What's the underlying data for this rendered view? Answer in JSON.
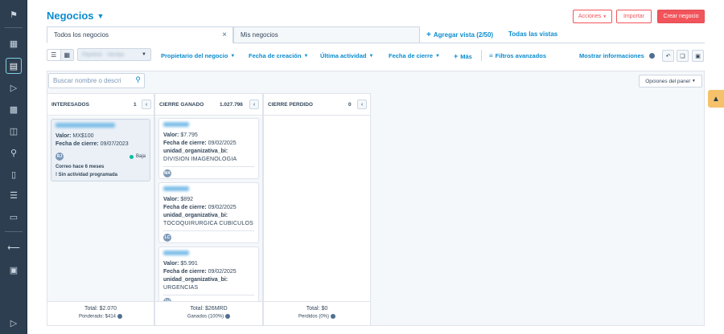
{
  "sidebar": {
    "icons": [
      "bookmark-icon",
      "apps-icon",
      "contacts-icon",
      "megaphone-icon",
      "document-icon",
      "inbox-icon",
      "network-icon",
      "reports-icon",
      "database-icon",
      "folder-icon",
      "collapse-icon",
      "settings-icon",
      "expand-icon"
    ]
  },
  "header": {
    "title": "Negocios",
    "actions_label": "Acciones",
    "import_label": "Importar",
    "create_label": "Crear negocio"
  },
  "tabs": {
    "items": [
      "Todos los negocios",
      "Mis negocios"
    ],
    "add_view": "Agregar vista (2/50)",
    "all_views": "Todas las vistas"
  },
  "filters": {
    "pipeline_value": "Pipeline · Ventas",
    "items": [
      "Propietario del negocio",
      "Fecha de creación",
      "Última actividad",
      "Fecha de cierre",
      "Más"
    ],
    "advanced": "Filtros avanzados",
    "show_info": "Mostrar informaciones"
  },
  "board": {
    "search_placeholder": "Buscar nombre o descri",
    "panel_options": "Opciones del panel",
    "columns": [
      {
        "title": "INTERESADOS",
        "count": "1",
        "total": "Total: $2.070",
        "subtotal": "Ponderado: $414",
        "cards": [
          {
            "value_label": "Valor:",
            "value": "MX$100",
            "date_label": "Fecha de cierre:",
            "date": "09/07/2023",
            "avatar": "RJ",
            "priority": "Baja",
            "activity": "Correo hace 6 meses",
            "next": "! Sin actividad programada"
          }
        ]
      },
      {
        "title": "CIERRE GANADO",
        "count": "1.027.796",
        "total": "Total: $26MRD",
        "subtotal": "Ganados (100%)",
        "cards": [
          {
            "value_label": "Valor:",
            "value": "$7.795",
            "date_label": "Fecha de cierre:",
            "date": "09/02/2025",
            "unit_label": "unidad_organizativa_bi:",
            "unit": "DIVISION IMAGENOLOGIA",
            "avatar": "MA"
          },
          {
            "value_label": "Valor:",
            "value": "$892",
            "date_label": "Fecha de cierre:",
            "date": "09/02/2025",
            "unit_label": "unidad_organizativa_bi:",
            "unit": "TOCOQUIRURGICA CUBICULOS",
            "avatar": "LC"
          },
          {
            "value_label": "Valor:",
            "value": "$5.991",
            "date_label": "Fecha de cierre:",
            "date": "09/02/2025",
            "unit_label": "unidad_organizativa_bi:",
            "unit": "URGENCIAS",
            "avatar": "CV"
          }
        ]
      },
      {
        "title": "CIERRE PERDIDO",
        "count": "0",
        "total": "Total: $0",
        "subtotal": "Perdidos (0%)",
        "cards": []
      }
    ]
  },
  "colors": {
    "accent": "#0b8ccf",
    "primary_button": "#f2545b",
    "sidebar": "#2d3e50",
    "widget": "#f5c26b"
  }
}
